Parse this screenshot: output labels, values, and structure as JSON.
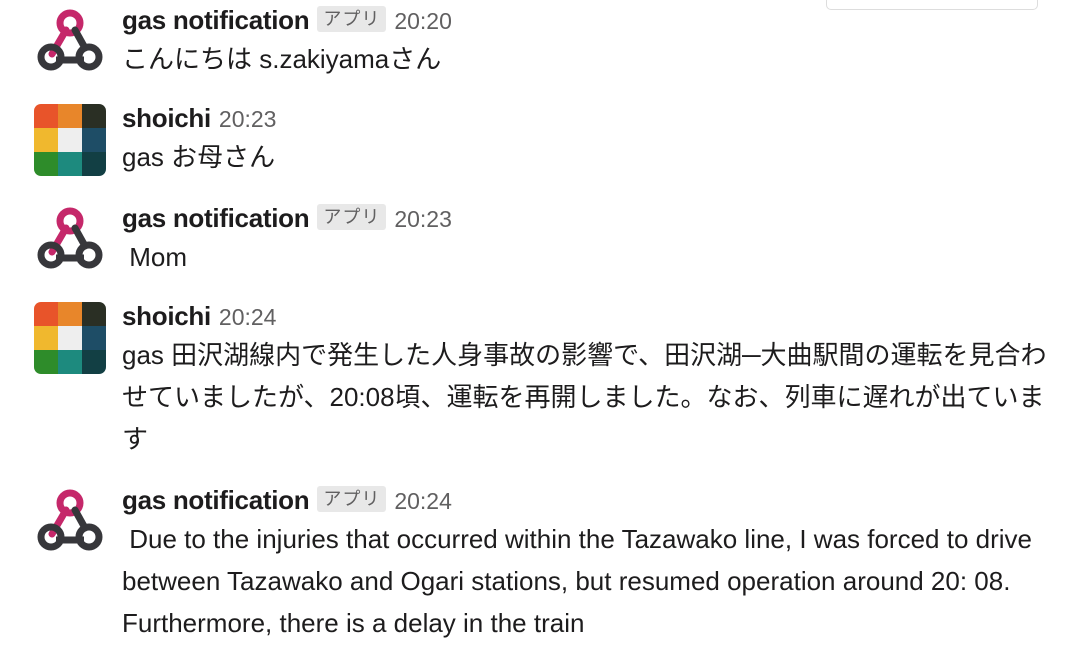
{
  "app": {
    "badge_label": "アプリ"
  },
  "messages": [
    {
      "sender": "gas notification",
      "is_app": true,
      "time": "20:20",
      "text": "こんにちは s.zakiyamaさん",
      "avatar_icon": "webhook-icon"
    },
    {
      "sender": "shoichi",
      "is_app": false,
      "time": "20:23",
      "text": "gas お母さん",
      "avatar_icon": "user-avatar"
    },
    {
      "sender": "gas notification",
      "is_app": true,
      "time": "20:23",
      "text": " Mom",
      "avatar_icon": "webhook-icon"
    },
    {
      "sender": "shoichi",
      "is_app": false,
      "time": "20:24",
      "text": "gas 田沢湖線内で発生した人身事故の影響で、田沢湖─大曲駅間の運転を見合わせていましたが、20:08頃、運転を再開しました。なお、列車に遅れが出ています",
      "avatar_icon": "user-avatar"
    },
    {
      "sender": "gas notification",
      "is_app": true,
      "time": "20:24",
      "text": " Due to the injuries that occurred within the Tazawako line, I was forced to drive between Tazawako and Ogari stations, but resumed operation around 20: 08. Furthermore, there is a delay in the train",
      "avatar_icon": "webhook-icon"
    }
  ],
  "colors": {
    "webhook_pink": "#c5286a",
    "webhook_dark": "#37373b",
    "timestamp": "#616061",
    "badge_bg": "#e8e8e8"
  }
}
